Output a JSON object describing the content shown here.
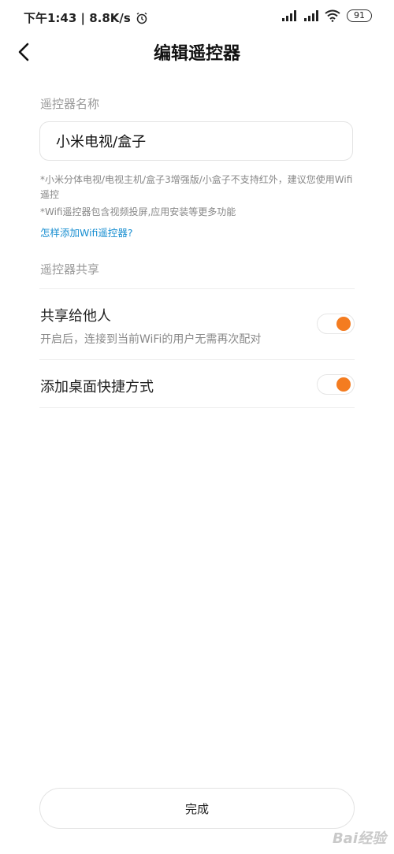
{
  "status_bar": {
    "time_speed": "下午1:43 | 8.8K/s",
    "battery": "91"
  },
  "header": {
    "title": "编辑遥控器"
  },
  "name_section": {
    "label": "遥控器名称",
    "input_value": "小米电视/盒子",
    "hint1": "*小米分体电视/电视主机/盒子3增强版/小盒子不支持红外，建议您使用Wifi遥控",
    "hint2": "*Wifi遥控器包含视频投屏,应用安装等更多功能",
    "link": "怎样添加Wifi遥控器?"
  },
  "share_section": {
    "label": "遥控器共享",
    "share_title": "共享给他人",
    "share_sub": "开启后，连接到当前WiFi的用户无需再次配对",
    "share_on": true,
    "shortcut_title": "添加桌面快捷方式",
    "shortcut_on": true
  },
  "done_button": "完成",
  "watermark": "Bai经验",
  "colors": {
    "accent": "#f47c20",
    "link": "#1a8fd1"
  }
}
